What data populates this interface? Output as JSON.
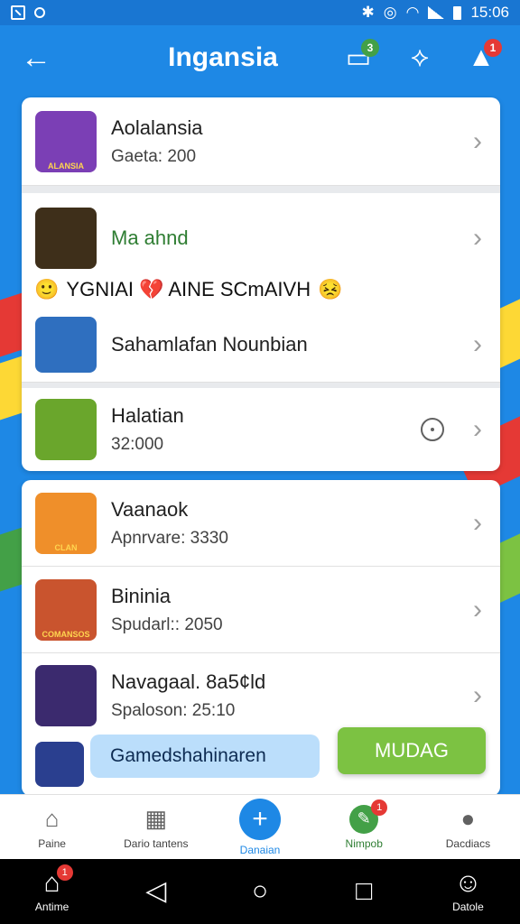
{
  "status_bar": {
    "time": "15:06"
  },
  "app_bar": {
    "back_glyph": "←",
    "title": "Ingansia",
    "icons": [
      {
        "name": "chat-icon",
        "glyph": "▭",
        "badge": "3",
        "badge_color": "green"
      },
      {
        "name": "share-icon",
        "glyph": "⟡",
        "badge": "",
        "badge_color": "red"
      },
      {
        "name": "notification-icon",
        "glyph": "▲",
        "badge": "1",
        "badge_color": "red"
      }
    ]
  },
  "list1": {
    "items": [
      {
        "title": "Aolalansia",
        "subtitle": "Gaeta: 200",
        "thumb_text": "ALANSIA",
        "thumb_color": "#7b3fb5"
      },
      {
        "title": "Ma ahnd",
        "subtitle": "",
        "thumb_text": "",
        "thumb_color": "#3e2f1a"
      },
      {
        "title": "Sahamlafan Nounbian",
        "subtitle": "",
        "thumb_text": "",
        "thumb_color": "#2f6fbf"
      },
      {
        "title": "Halatian",
        "subtitle": "32:000",
        "thumb_text": "",
        "thumb_color": "#6aa62c"
      }
    ],
    "promo": {
      "lead_emoji": "🙂",
      "text": "YGNIAI 💔 AINE SCmAIVH",
      "tail_emoji": "😣"
    }
  },
  "list2": {
    "items": [
      {
        "title": "Vaanaok",
        "subtitle": "Apnrvare: 3330",
        "thumb_text": "CLAN",
        "thumb_color": "#ef8f2a"
      },
      {
        "title": "Bininia",
        "subtitle": "Spudarl:: 2050",
        "thumb_text": "COMANSOS",
        "thumb_color": "#c9542e"
      },
      {
        "title": "Navagaal. 8a5¢ld",
        "subtitle": "Spaloson: 25:10",
        "thumb_text": "",
        "thumb_color": "#3b2a6e"
      }
    ]
  },
  "search": {
    "text": "Gamedshahinaren"
  },
  "cta": {
    "label": "MUDAG"
  },
  "bottom_nav": [
    {
      "name": "nav-home",
      "label": "Paine",
      "icon": "home-icon",
      "glyph": "⌂",
      "badge": ""
    },
    {
      "name": "nav-dashboard",
      "label": "Dario tantens",
      "icon": "dashboard-icon",
      "glyph": "▦",
      "badge": ""
    },
    {
      "name": "nav-add",
      "label": "Danaian",
      "icon": "add-icon",
      "glyph": "+",
      "badge": ""
    },
    {
      "name": "nav-map",
      "label": "Nimpob",
      "icon": "leaf-icon",
      "glyph": "✎",
      "badge": "1"
    },
    {
      "name": "nav-profile",
      "label": "Dacdiacs",
      "icon": "profile-icon",
      "glyph": "●",
      "badge": ""
    }
  ],
  "system_nav": [
    {
      "name": "sys-home",
      "label": "Antime",
      "glyph": "⌂",
      "badge": "1"
    },
    {
      "name": "sys-back",
      "label": "",
      "glyph": "◁",
      "badge": ""
    },
    {
      "name": "sys-circle",
      "label": "",
      "glyph": "○",
      "badge": ""
    },
    {
      "name": "sys-recent",
      "label": "",
      "glyph": "□",
      "badge": ""
    },
    {
      "name": "sys-account",
      "label": "Datole",
      "glyph": "☺",
      "badge": ""
    }
  ]
}
